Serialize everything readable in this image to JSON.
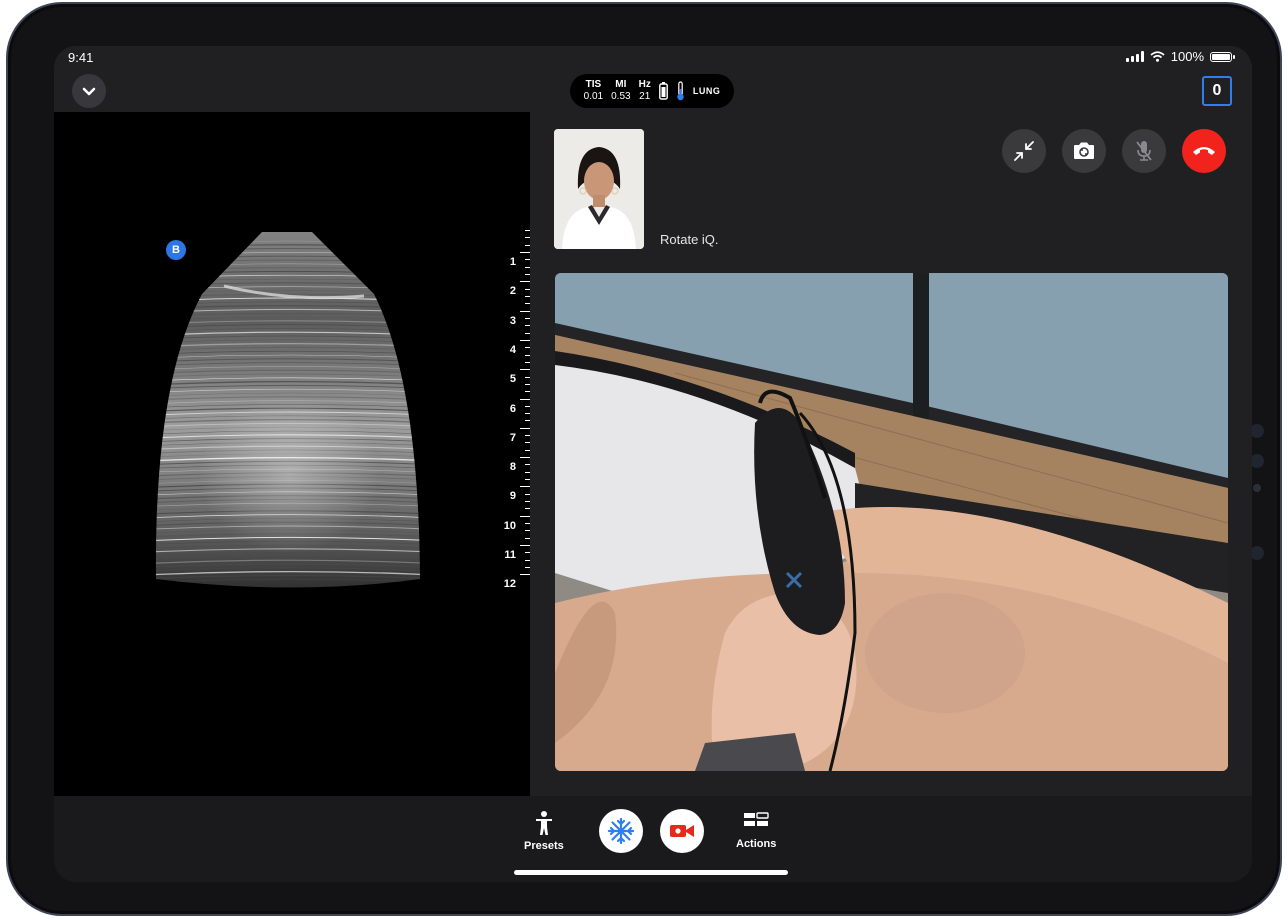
{
  "status_bar": {
    "time": "9:41",
    "battery_text": "100%",
    "battery_level": 1.0
  },
  "top_bar": {
    "metrics": [
      {
        "label": "TIS",
        "value": "0.01"
      },
      {
        "label": "MI",
        "value": "0.53"
      },
      {
        "label": "Hz",
        "value": "21"
      }
    ],
    "preset": "LUNG",
    "count": "0"
  },
  "ultrasound": {
    "badge": "B",
    "depth_ticks": [
      "1",
      "2",
      "3",
      "4",
      "5",
      "6",
      "7",
      "8",
      "9",
      "10",
      "11",
      "12"
    ]
  },
  "call": {
    "caller_name": "Rotate iQ.",
    "controls": [
      "minimize-icon",
      "camera-switch-icon",
      "mic-muted-icon",
      "end-call-icon"
    ]
  },
  "toolbar": {
    "presets_label": "Presets",
    "actions_label": "Actions"
  },
  "colors": {
    "accent": "#2d7ff0",
    "end_call": "#f2231c",
    "record": "#e8281e"
  }
}
